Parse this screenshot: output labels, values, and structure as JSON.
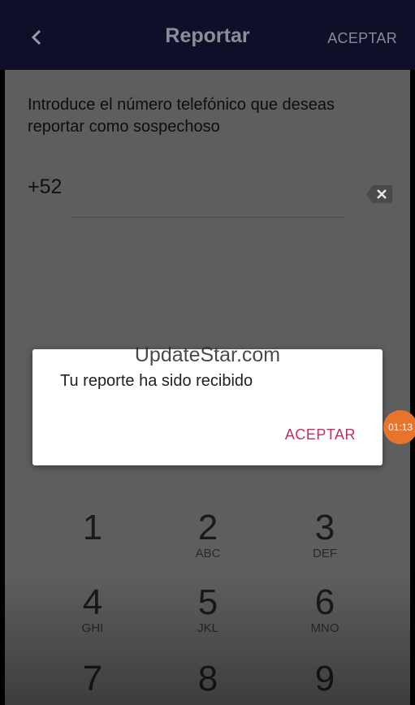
{
  "appbar": {
    "title": "Reportar",
    "action_label": "ACEPTAR",
    "back_icon": "chevron-left-icon"
  },
  "form": {
    "instruction": "Introduce el número telefónico que deseas reportar como sospechoso",
    "phone_value": "+52",
    "backspace_icon": "backspace-icon"
  },
  "dialog": {
    "message": "Tu reporte ha sido recibido",
    "accept_label": "ACEPTAR"
  },
  "watermark": "UpdateStar.com",
  "timer_badge": "01:13",
  "keypad": {
    "keys": [
      {
        "digit": "1",
        "letters": ""
      },
      {
        "digit": "2",
        "letters": "ABC"
      },
      {
        "digit": "3",
        "letters": "DEF"
      },
      {
        "digit": "4",
        "letters": "GHI"
      },
      {
        "digit": "5",
        "letters": "JKL"
      },
      {
        "digit": "6",
        "letters": "MNO"
      },
      {
        "digit": "7",
        "letters": ""
      },
      {
        "digit": "8",
        "letters": ""
      },
      {
        "digit": "9",
        "letters": ""
      }
    ]
  },
  "colors": {
    "appbar_bg": "#0f0f2a",
    "accent": "#c0305a",
    "timer_badge": "#e8732a"
  }
}
